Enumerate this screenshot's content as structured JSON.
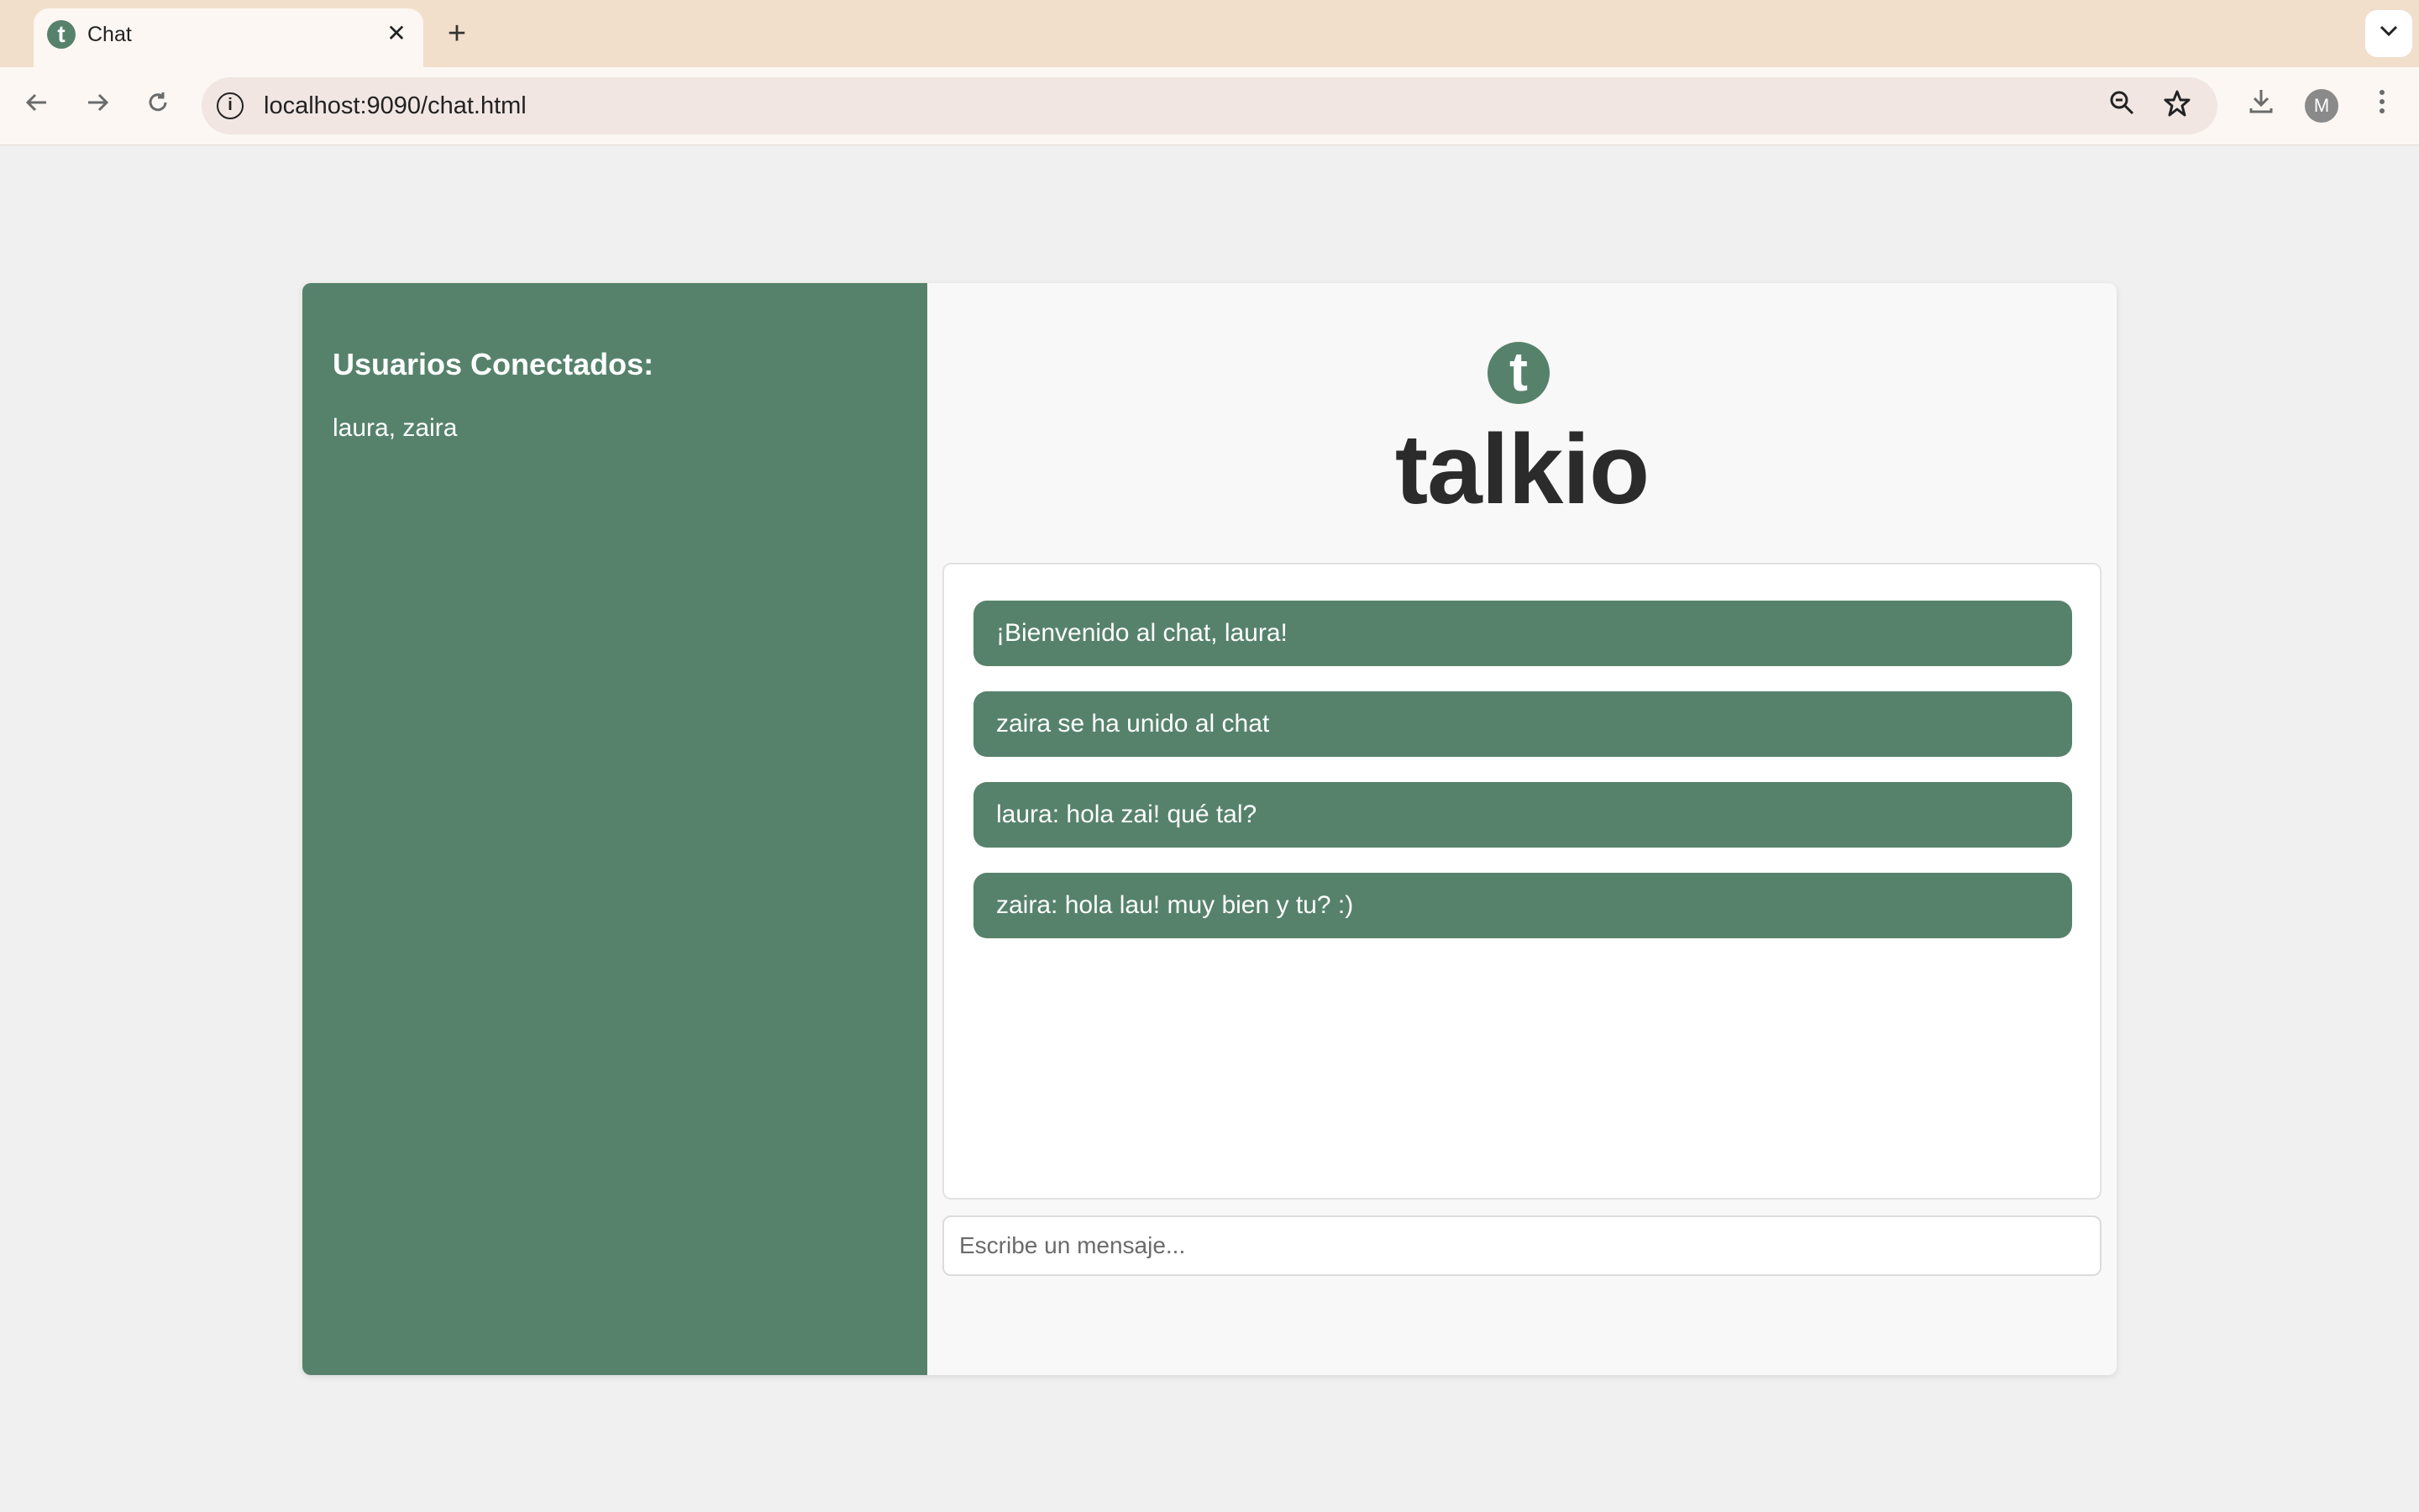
{
  "browser": {
    "tab_title": "Chat",
    "tab_favicon_letter": "t",
    "url": "localhost:9090/chat.html",
    "profile_initial": "M"
  },
  "sidebar": {
    "title": "Usuarios Conectados:",
    "users": "laura, zaira"
  },
  "header": {
    "logo_letter": "t",
    "app_name": "talkio"
  },
  "messages": [
    {
      "text": "¡Bienvenido al chat, laura!"
    },
    {
      "text": "zaira se ha unido al chat"
    },
    {
      "text": "laura: hola zai! qué tal?"
    },
    {
      "text": "zaira: hola lau! muy bien y tu? :)"
    }
  ],
  "composer": {
    "placeholder": "Escribe un mensaje...",
    "value": ""
  },
  "colors": {
    "accent": "#56826b",
    "tabstrip": "#f1dfcc",
    "page_bg": "#f0f0f0"
  }
}
